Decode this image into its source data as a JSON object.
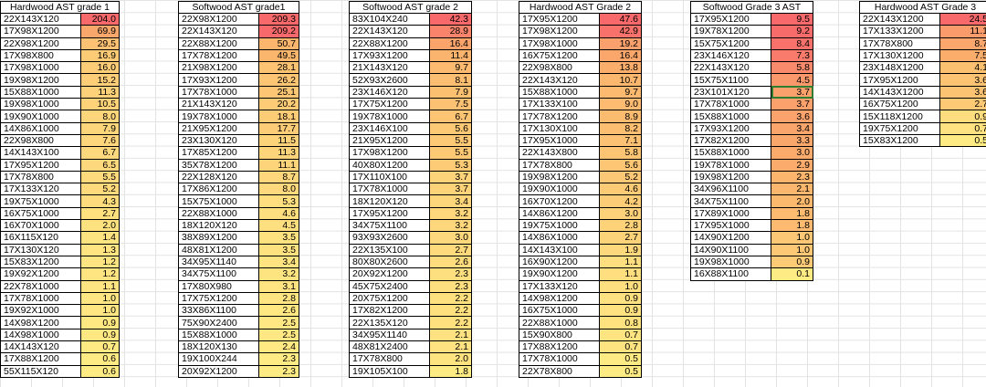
{
  "sheet": {
    "tables": [
      {
        "title": "Hardwood AST grade 1",
        "rows": [
          [
            "22X143X120",
            "204.0"
          ],
          [
            "17X98X1200",
            "69.9"
          ],
          [
            "22X98X1200",
            "29.5"
          ],
          [
            "17X98X800",
            "16.9"
          ],
          [
            "17X98X1000",
            "16.0"
          ],
          [
            "19X98X1200",
            "15.2"
          ],
          [
            "15X88X1000",
            "11.3"
          ],
          [
            "19X98X1000",
            "10.5"
          ],
          [
            "19X90X1000",
            "8.0"
          ],
          [
            "14X86X1000",
            "7.9"
          ],
          [
            "22X98X800",
            "7.6"
          ],
          [
            "14X143X100",
            "6.7"
          ],
          [
            "17X95X1200",
            "6.5"
          ],
          [
            "17X78X800",
            "5.5"
          ],
          [
            "17X133X120",
            "5.2"
          ],
          [
            "19X75X1000",
            "4.3"
          ],
          [
            "16X75X1000",
            "2.7"
          ],
          [
            "16X70X1000",
            "2.0"
          ],
          [
            "16X115X120",
            "1.4"
          ],
          [
            "17X130X120",
            "1.3"
          ],
          [
            "15X83X1200",
            "1.2"
          ],
          [
            "19X92X1200",
            "1.2"
          ],
          [
            "22X78X1000",
            "1.1"
          ],
          [
            "17X78X1000",
            "1.0"
          ],
          [
            "19X92X1000",
            "1.0"
          ],
          [
            "14X98X1200",
            "0.9"
          ],
          [
            "14X98X1000",
            "0.9"
          ],
          [
            "14X143X120",
            "0.7"
          ],
          [
            "17X88X1200",
            "0.6"
          ],
          [
            "55X115X120",
            "0.6"
          ]
        ]
      },
      {
        "title": "Softwood AST grade1",
        "rows": [
          [
            "22X98X1200",
            "209.3"
          ],
          [
            "22X143X120",
            "209.2"
          ],
          [
            "22X88X1200",
            "50.7"
          ],
          [
            "17X78X1200",
            "49.5"
          ],
          [
            "21X98X1200",
            "28.1"
          ],
          [
            "17X93X1200",
            "26.2"
          ],
          [
            "17X78X1000",
            "25.1"
          ],
          [
            "21X143X120",
            "20.2"
          ],
          [
            "19X78X1000",
            "18.1"
          ],
          [
            "21X95X1200",
            "17.7"
          ],
          [
            "23X130X120",
            "11.5"
          ],
          [
            "17X85X1200",
            "11.3"
          ],
          [
            "35X78X1200",
            "11.1"
          ],
          [
            "22X128X120",
            "8.7"
          ],
          [
            "17X86X1200",
            "8.0"
          ],
          [
            "15X75X1000",
            "5.3"
          ],
          [
            "22X88X1000",
            "4.6"
          ],
          [
            "18X120X120",
            "4.5"
          ],
          [
            "38X89X1200",
            "3.5"
          ],
          [
            "48X81X1200",
            "3.5"
          ],
          [
            "34X95X1140",
            "3.4"
          ],
          [
            "34X75X1100",
            "3.2"
          ],
          [
            "17X80X980",
            "3.1"
          ],
          [
            "17X75X1200",
            "2.8"
          ],
          [
            "33X86X1100",
            "2.6"
          ],
          [
            "75X90X2400",
            "2.5"
          ],
          [
            "15X88X1000",
            "2.5"
          ],
          [
            "18X120X130",
            "2.4"
          ],
          [
            "19X100X244",
            "2.3"
          ],
          [
            "20X92X1200",
            "2.3"
          ]
        ]
      },
      {
        "title": "Softwood AST grade 2",
        "rows": [
          [
            "83X104X240",
            "42.3"
          ],
          [
            "22X143X120",
            "28.9"
          ],
          [
            "22X88X1200",
            "16.4"
          ],
          [
            "17X93X1200",
            "11.4"
          ],
          [
            "21X143X120",
            "9.7"
          ],
          [
            "52X93X2600",
            "8.1"
          ],
          [
            "23X146X120",
            "7.9"
          ],
          [
            "17X75X1200",
            "7.5"
          ],
          [
            "19X78X1000",
            "6.7"
          ],
          [
            "23X146X100",
            "5.6"
          ],
          [
            "21X95X1200",
            "5.5"
          ],
          [
            "17X98X1200",
            "5.5"
          ],
          [
            "40X80X1200",
            "5.3"
          ],
          [
            "17X110X100",
            "3.7"
          ],
          [
            "17X78X1000",
            "3.7"
          ],
          [
            "18X120X120",
            "3.4"
          ],
          [
            "17X95X1200",
            "3.2"
          ],
          [
            "34X75X1100",
            "3.2"
          ],
          [
            "93X93X2600",
            "3.0"
          ],
          [
            "22X135X100",
            "2.7"
          ],
          [
            "80X80X2600",
            "2.6"
          ],
          [
            "20X92X1200",
            "2.3"
          ],
          [
            "45X75X2400",
            "2.3"
          ],
          [
            "20X75X1200",
            "2.2"
          ],
          [
            "17X82X1200",
            "2.2"
          ],
          [
            "22X135X120",
            "2.2"
          ],
          [
            "34X95X1140",
            "2.1"
          ],
          [
            "48X81X2400",
            "2.1"
          ],
          [
            "17X78X800",
            "2.0"
          ],
          [
            "19X105X100",
            "1.8"
          ]
        ]
      },
      {
        "title": "Hardwood AST Grade 2",
        "rows": [
          [
            "17X95X1200",
            "47.6"
          ],
          [
            "17X98X1200",
            "42.9"
          ],
          [
            "17X98X1000",
            "19.2"
          ],
          [
            "16X75X1200",
            "16.4"
          ],
          [
            "22X98X800",
            "13.8"
          ],
          [
            "22X143X120",
            "10.7"
          ],
          [
            "15X88X1000",
            "9.7"
          ],
          [
            "17X133X100",
            "9.0"
          ],
          [
            "17X78X1200",
            "8.9"
          ],
          [
            "17X130X100",
            "8.2"
          ],
          [
            "17X95X1000",
            "7.1"
          ],
          [
            "22X143X800",
            "5.8"
          ],
          [
            "17X78X800",
            "5.6"
          ],
          [
            "19X98X1200",
            "5.2"
          ],
          [
            "19X90X1000",
            "4.6"
          ],
          [
            "16X70X1200",
            "4.2"
          ],
          [
            "14X86X1200",
            "3.0"
          ],
          [
            "19X75X1000",
            "2.8"
          ],
          [
            "14X86X1000",
            "2.7"
          ],
          [
            "14X143X100",
            "1.9"
          ],
          [
            "16X90X1200",
            "1.1"
          ],
          [
            "19X90X1200",
            "1.1"
          ],
          [
            "17X133X120",
            "1.0"
          ],
          [
            "14X98X1200",
            "0.9"
          ],
          [
            "16X75X1000",
            "0.9"
          ],
          [
            "22X88X1000",
            "0.8"
          ],
          [
            "15X90X800",
            "0.7"
          ],
          [
            "17X88X1200",
            "0.7"
          ],
          [
            "17X78X1000",
            "0.5"
          ],
          [
            "22X78X800",
            "0.5"
          ]
        ]
      },
      {
        "title": "Softwood Grade 3 AST",
        "rows": [
          [
            "17X95X1200",
            "9.5"
          ],
          [
            "19X78X1200",
            "9.2"
          ],
          [
            "15X75X1200",
            "8.4"
          ],
          [
            "23X146X120",
            "7.3"
          ],
          [
            "22X143X120",
            "5.8"
          ],
          [
            "15X75X1100",
            "4.5"
          ],
          [
            "23X101X120",
            "3.7"
          ],
          [
            "17X78X1000",
            "3.7"
          ],
          [
            "15X88X1000",
            "3.6"
          ],
          [
            "17X93X1200",
            "3.4"
          ],
          [
            "17X82X1200",
            "3.3"
          ],
          [
            "15X88X1000",
            "3.0"
          ],
          [
            "19X78X1000",
            "2.9"
          ],
          [
            "19X98X1200",
            "2.3"
          ],
          [
            "34X96X1100",
            "2.1"
          ],
          [
            "34X75X1100",
            "2.0"
          ],
          [
            "17X89X1000",
            "1.8"
          ],
          [
            "17X95X1000",
            "1.8"
          ],
          [
            "14X90X1200",
            "1.0"
          ],
          [
            "14X90X1100",
            "1.0"
          ],
          [
            "19X98X1000",
            "0.9"
          ],
          [
            "16X88X1100",
            "0.1"
          ]
        ]
      },
      {
        "title": "Hardwood AST Grade 3",
        "rows": [
          [
            "22X143X1200",
            "24.5"
          ],
          [
            "17X133X1200",
            "11.1"
          ],
          [
            "17X78X800",
            "8.7"
          ],
          [
            "17X130X1200",
            "7.5"
          ],
          [
            "23X148X1200",
            "4.1"
          ],
          [
            "17X95X1200",
            "3.6"
          ],
          [
            "14X143X1200",
            "3.6"
          ],
          [
            "16X75X1200",
            "2.7"
          ],
          [
            "15X118X1200",
            "0.9"
          ],
          [
            "19X75X1200",
            "0.7"
          ],
          [
            "15X83X1200",
            "0.5"
          ]
        ]
      }
    ],
    "colors": {
      "scale_high": "#f8696b",
      "scale_mid": "#fbb36c",
      "scale_low": "#ffeb84",
      "cell_selection": "#2e7d32"
    },
    "selected_cell": {
      "table": 4,
      "row": 6
    }
  }
}
